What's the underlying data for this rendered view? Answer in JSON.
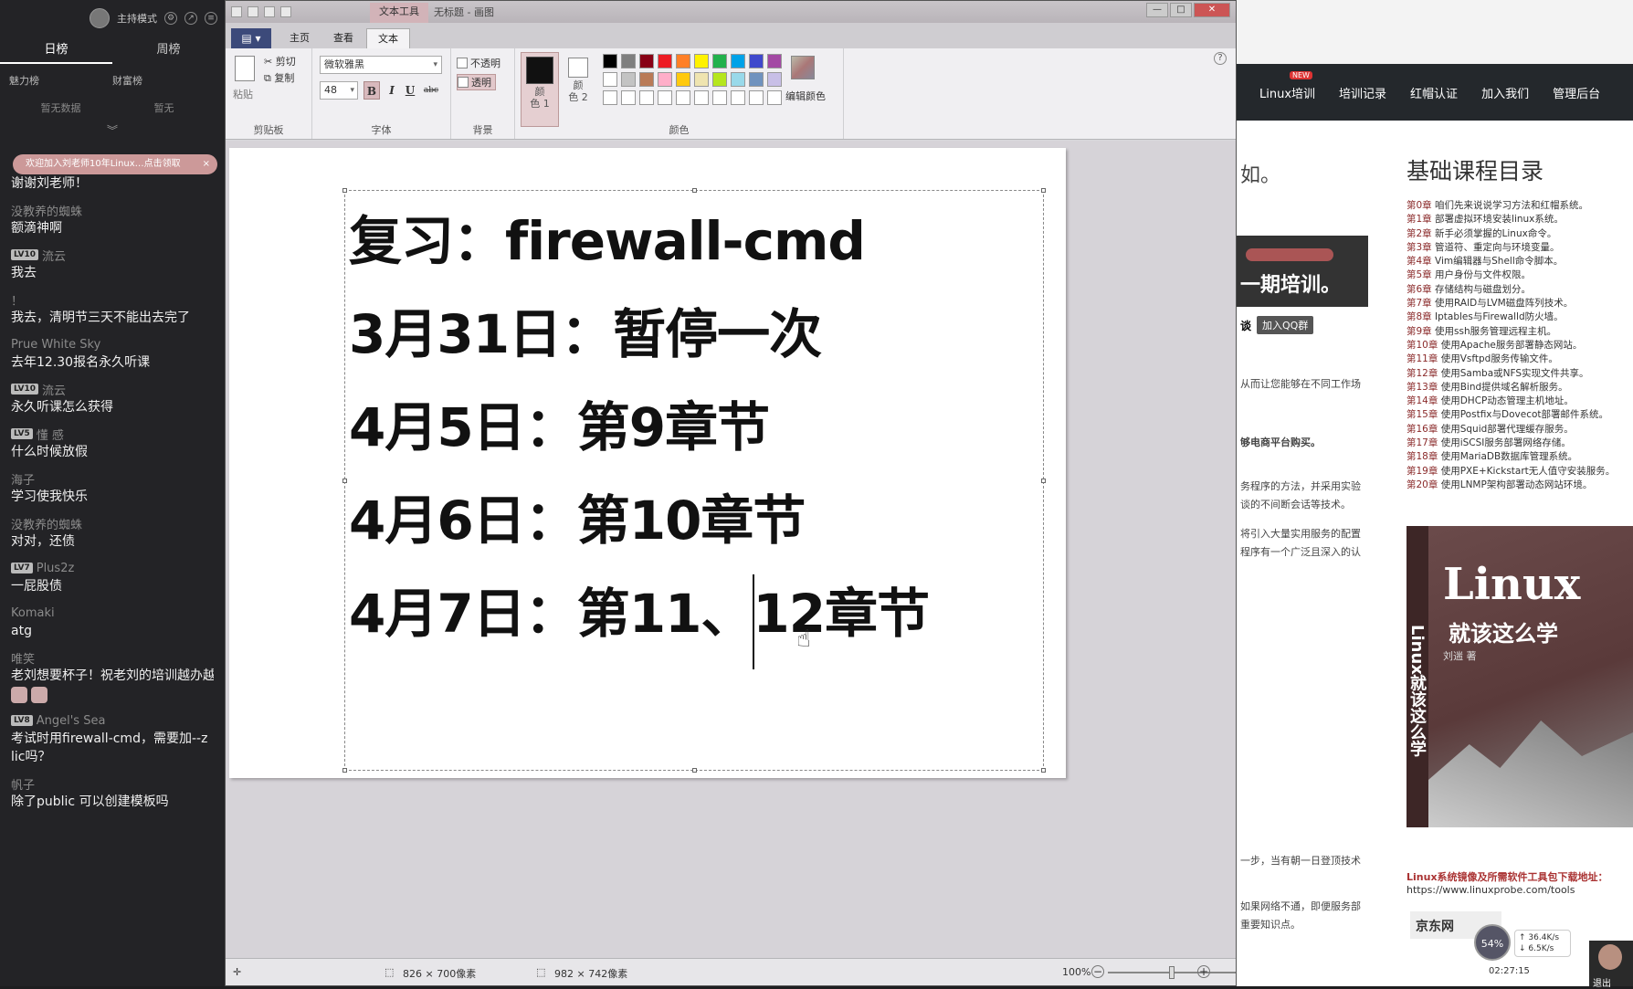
{
  "chat": {
    "top_label": "主持模式",
    "rank_tabs": [
      "日榜",
      "周榜"
    ],
    "sub_tabs": [
      "魅力榜",
      "财富榜"
    ],
    "no_data": [
      "暂无数据",
      "暂无"
    ],
    "notice": "欢迎加入刘老师10年Linux…点击领取",
    "notice_close": "×",
    "first_message": "谢谢刘老师！",
    "messages": [
      {
        "user": "没教养的蜘蛛",
        "level": "",
        "text": "额滴神啊"
      },
      {
        "user": "流云",
        "level": "LV10",
        "text": "我去"
      },
      {
        "user": "！",
        "level": "",
        "text": "我去，清明节三天不能出去完了"
      },
      {
        "user": "Prue White Sky",
        "level": "",
        "text": "去年12.30报名永久听课"
      },
      {
        "user": "流云",
        "level": "LV10",
        "text": "永久听课怎么获得"
      },
      {
        "user": "懂 感",
        "level": "LV5",
        "text": "什么时候放假"
      },
      {
        "user": "海子",
        "level": "",
        "text": "学习使我快乐"
      },
      {
        "user": "没教养的蜘蛛",
        "level": "",
        "text": "对对，还债"
      },
      {
        "user": "Plus2z",
        "level": "LV7",
        "text": "一屁股债"
      },
      {
        "user": "Komaki",
        "level": "",
        "text": "atg"
      },
      {
        "user": "唯笑",
        "level": "",
        "text": "老刘想要杯子！祝老刘的培训越办越"
      },
      {
        "user": "Angel's Sea",
        "level": "LV8",
        "text": "考试时用firewall-cmd，需要加--z"
      },
      {
        "user": "",
        "level": "",
        "text": "lic吗？"
      },
      {
        "user": "帆子",
        "level": "",
        "text": "除了public 可以创建模板吗"
      }
    ]
  },
  "paint": {
    "context_tab": "文本工具",
    "window_title": "无标题 - 画图",
    "window_controls": [
      "—",
      "□",
      "✕"
    ],
    "menu_button": "▤ ▾",
    "tabs": [
      "主页",
      "查看",
      "文本"
    ],
    "clipboard": {
      "paste": "粘贴",
      "cut": "剪切",
      "copy": "复制",
      "group": "剪贴板"
    },
    "font": {
      "name": "微软雅黑",
      "size": "48",
      "bold": "B",
      "italic": "I",
      "underline": "U",
      "strike": "abc",
      "group": "字体"
    },
    "background": {
      "opaque": "不透明",
      "transparent": "透明",
      "group": "背景"
    },
    "colors": {
      "color1_label": "颜\n色 1",
      "color2_label": "颜\n色 2",
      "edit_label": "编辑颜色",
      "group": "颜色",
      "palette": [
        "#000000",
        "#7f7f7f",
        "#880015",
        "#ed1c24",
        "#ff7f27",
        "#fff200",
        "#22b14c",
        "#00a2e8",
        "#3f48cc",
        "#a349a4",
        "#ffffff",
        "#c3c3c3",
        "#b97a57",
        "#ffaec9",
        "#ffc90e",
        "#efe4b0",
        "#b5e61d",
        "#99d9ea",
        "#7092be",
        "#c8bfe7",
        "#ffffff",
        "#ffffff",
        "#ffffff",
        "#ffffff",
        "#ffffff",
        "#ffffff",
        "#ffffff",
        "#ffffff",
        "#ffffff",
        "#ffffff"
      ]
    },
    "canvas_lines": [
      "复习：firewall-cmd",
      "3月31日：暂停一次",
      "4月5日：第9章节",
      "4月6日：第10章节",
      "4月7日：第11、12章节"
    ],
    "status": {
      "selection_size": "826 × 700像素",
      "canvas_size": "982 × 742像素",
      "zoom": "100%",
      "zoom_level": 1.0
    }
  },
  "web": {
    "nav": [
      "Linux培训",
      "培训记录",
      "红帽认证",
      "加入我们",
      "管理后台"
    ],
    "nav_badge": "NEW",
    "toc_title": "基础课程目录",
    "toc": [
      [
        "第0章",
        "咱们先来说说学习方法和红帽系统。"
      ],
      [
        "第1章",
        "部署虚拟环境安装linux系统。"
      ],
      [
        "第2章",
        "新手必须掌握的Linux命令。"
      ],
      [
        "第3章",
        "管道符、重定向与环境变量。"
      ],
      [
        "第4章",
        "Vim编辑器与Shell命令脚本。"
      ],
      [
        "第5章",
        "用户身份与文件权限。"
      ],
      [
        "第6章",
        "存储结构与磁盘划分。"
      ],
      [
        "第7章",
        "使用RAID与LVM磁盘阵列技术。"
      ],
      [
        "第8章",
        "Iptables与Firewalld防火墙。"
      ],
      [
        "第9章",
        "使用ssh服务管理远程主机。"
      ],
      [
        "第10章",
        "使用Apache服务部署静态网站。"
      ],
      [
        "第11章",
        "使用Vsftpd服务传输文件。"
      ],
      [
        "第12章",
        "使用Samba或NFS实现文件共享。"
      ],
      [
        "第13章",
        "使用Bind提供域名解析服务。"
      ],
      [
        "第14章",
        "使用DHCP动态管理主机地址。"
      ],
      [
        "第15章",
        "使用Postfix与Dovecot部署邮件系统。"
      ],
      [
        "第16章",
        "使用Squid部署代理缓存服务。"
      ],
      [
        "第17章",
        "使用iSCSI服务部署网络存储。"
      ],
      [
        "第18章",
        "使用MariaDB数据库管理系统。"
      ],
      [
        "第19章",
        "使用PXE+Kickstart无人值守安装服务。"
      ],
      [
        "第20章",
        "使用LNMP架构部署动态网站环境。"
      ]
    ],
    "left_fragments": [
      "如。",
      "从而让您能够在不同工作场",
      "务程序的方法，并采用实验",
      "谈的不间断会话等技术。",
      "将引入大量实用服务的配置",
      "程序有一个广泛且深入的认",
      "一步，当有朝一日登顶技术",
      "如果网络不通，即便服务部",
      "重要知识点。",
      "够电商平台购买。"
    ],
    "promo_text": "一期培训。",
    "qq_label": "谈",
    "qq_button": "加入QQ群",
    "book_title": "Linux",
    "book_subtitle": "就该这么学",
    "book_spine": "Linux就该这么学",
    "book_author": "刘遄 著",
    "download_label": "Linux系统镜像及所需软件工具包下载地址：",
    "download_url": "https://www.linuxprobe.com/tools",
    "jd": "京东网"
  },
  "overlay": {
    "cpu": "54%",
    "up_speed": "↑ 36.4K/s",
    "down_speed": "↓ 6.5K/s",
    "clock": "02:27:15",
    "exit": "退出"
  }
}
